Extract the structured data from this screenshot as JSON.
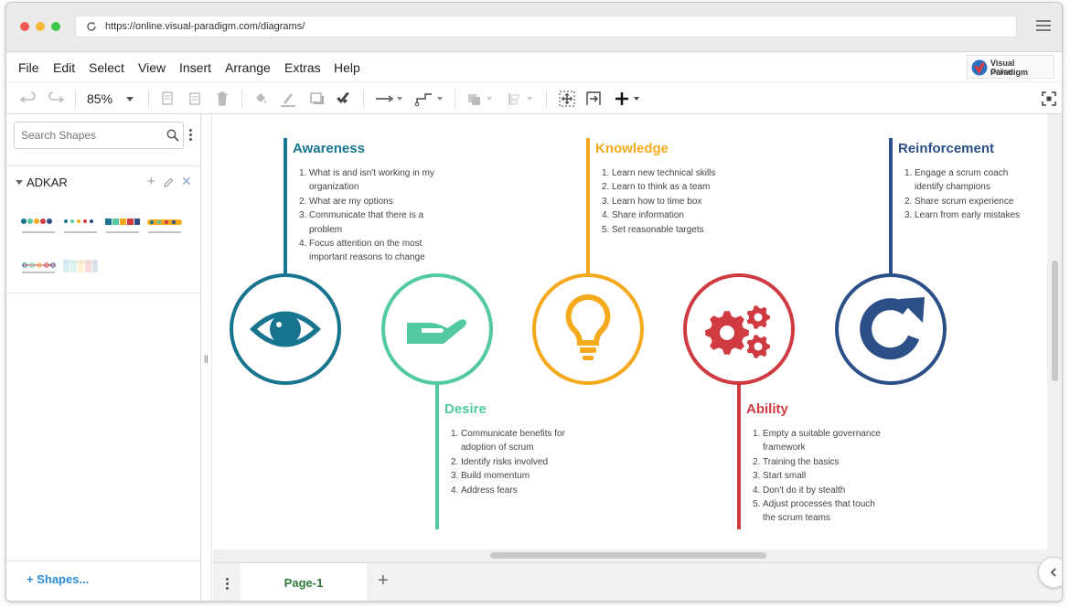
{
  "browser": {
    "url": "https://online.visual-paradigm.com/diagrams/",
    "colors": {
      "red": "#ee5a52",
      "yellow": "#f5b83a",
      "green": "#3cc74a"
    }
  },
  "menubar": {
    "items": [
      "File",
      "Edit",
      "Select",
      "View",
      "Insert",
      "Arrange",
      "Extras",
      "Help"
    ],
    "logo": {
      "line1": "Visual Paradigm",
      "line2": "Online"
    }
  },
  "toolbar": {
    "zoom": "85%",
    "icons": [
      "undo-icon",
      "redo-icon",
      "zoom-dropdown-icon",
      "copy-icon",
      "paste-icon",
      "delete-icon",
      "fill-color-icon",
      "line-color-icon",
      "shadow-icon",
      "format-painter-icon",
      "connector-arrow-icon",
      "waypoint-icon",
      "to-front-icon",
      "align-icon",
      "fit-page-icon",
      "page-width-icon",
      "insert-icon",
      "fullscreen-icon"
    ]
  },
  "sidebar": {
    "search_placeholder": "Search Shapes",
    "section_title": "ADKAR",
    "shapes_link": "Shapes..."
  },
  "pages": {
    "tabs": [
      "Page-1"
    ]
  },
  "diagram": {
    "stages": [
      {
        "title": "Awareness",
        "color": "#17758f",
        "icon": "eye-icon",
        "items": [
          "What is and isn't working in my organization",
          "What are my options",
          "Communicate that there is a problem",
          "Focus attention on the most important reasons to change"
        ]
      },
      {
        "title": "Desire",
        "color": "#52c9a3",
        "icon": "open-hand-icon",
        "items": [
          "Communicate benefits for adoption of scrum",
          "Identify risks involved",
          "Build momentum",
          "Address fears"
        ]
      },
      {
        "title": "Knowledge",
        "color": "#f5a91c",
        "icon": "lightbulb-icon",
        "items": [
          "Learn new technical skills",
          "Learn to think as a team",
          "Learn how to time box",
          "Share information",
          "Set reasonable targets"
        ]
      },
      {
        "title": "Ability",
        "color": "#d03b42",
        "icon": "gears-icon",
        "items": [
          "Empty a suitable governance framework",
          "Training the basics",
          "Start small",
          "Don't do it by stealth",
          "Adjust processes that touch the scrum teams"
        ]
      },
      {
        "title": "Reinforcement",
        "color": "#2b4f86",
        "icon": "refresh-icon",
        "items": [
          "Engage a scrum coach identify champions",
          "Share scrum experience",
          "Learn from early mistakes"
        ]
      }
    ]
  }
}
